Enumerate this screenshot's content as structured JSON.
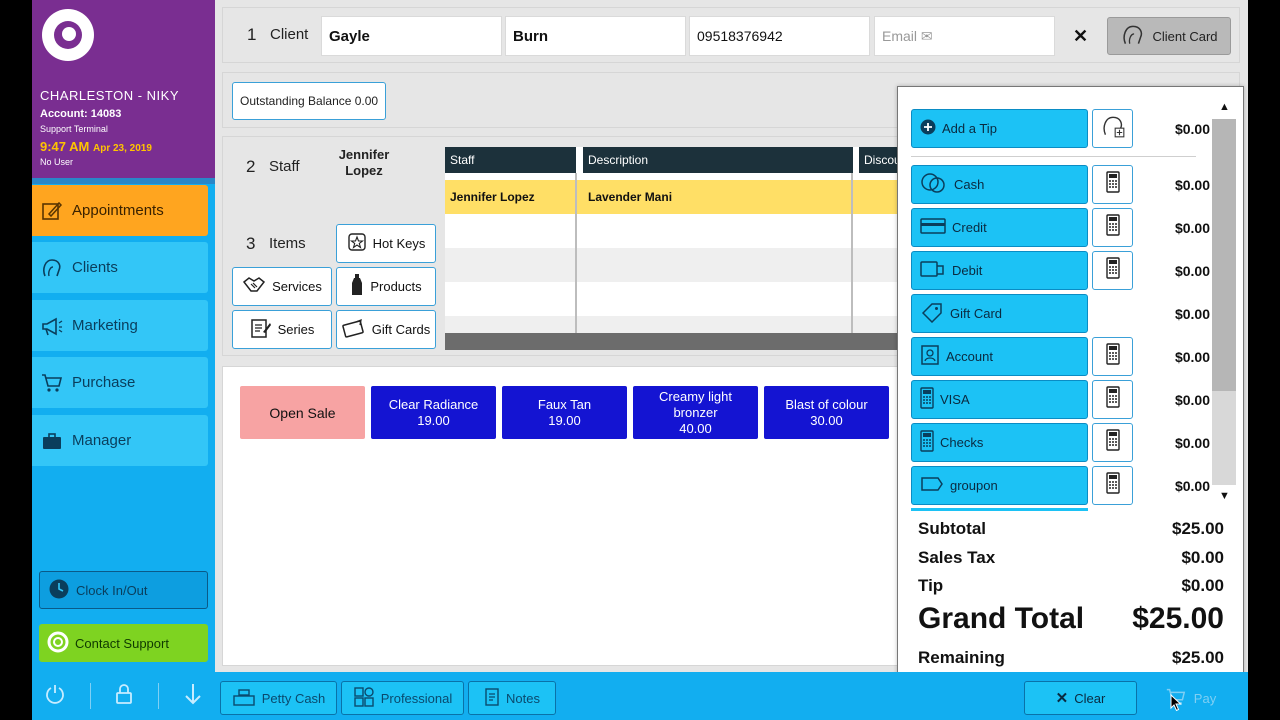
{
  "sidebar": {
    "location": "CHARLESTON - NIKY",
    "account": "Account: 14083",
    "terminal": "Support Terminal",
    "time": "9:47 AM",
    "date": "Apr 23, 2019",
    "user": "No User",
    "nav": [
      {
        "label": "Appointments",
        "icon": "calendar-edit-icon",
        "active": true
      },
      {
        "label": "Clients",
        "icon": "client-head-icon",
        "active": false
      },
      {
        "label": "Marketing",
        "icon": "megaphone-icon",
        "active": false
      },
      {
        "label": "Purchase",
        "icon": "cart-icon",
        "active": false
      },
      {
        "label": "Manager",
        "icon": "briefcase-icon",
        "active": false
      }
    ],
    "clock_button": "Clock In/Out",
    "support_button": "Contact Support",
    "footer_icons": [
      "power-icon",
      "lock-icon",
      "arrow-down-icon"
    ]
  },
  "client": {
    "step": "1",
    "label": "Client",
    "first_name": "Gayle",
    "last_name": "Burn",
    "phone": "09518376942",
    "email_placeholder": "Email ✉",
    "card_button": "Client Card"
  },
  "balance": "Outstanding Balance 0.00",
  "staff": {
    "step": "2",
    "label": "Staff",
    "name": "Jennifer Lopez"
  },
  "items": {
    "step": "3",
    "label": "Items",
    "tiles": {
      "hot_keys": "Hot Keys",
      "services": "Services",
      "products": "Products",
      "series": "Series",
      "gift_cards": "Gift Cards"
    }
  },
  "grid": {
    "headers": {
      "staff": "Staff",
      "description": "Description",
      "discount": "Discou"
    },
    "rows": [
      {
        "staff": "Jennifer Lopez",
        "description": "Lavender Mani"
      }
    ]
  },
  "hotkeys": {
    "open_sale": "Open Sale",
    "items": [
      {
        "name": "Clear Radiance",
        "price": "19.00"
      },
      {
        "name": "Faux Tan",
        "price": "19.00"
      },
      {
        "name": "Creamy light bronzer",
        "price": "40.00"
      },
      {
        "name": "Blast of colour",
        "price": "30.00"
      }
    ]
  },
  "payment": {
    "tip": {
      "label": "Add a Tip",
      "amount": "$0.00"
    },
    "methods": [
      {
        "label": "Cash",
        "amount": "$0.00",
        "calc": true
      },
      {
        "label": "Credit",
        "amount": "$0.00",
        "calc": true
      },
      {
        "label": "Debit",
        "amount": "$0.00",
        "calc": true
      },
      {
        "label": "Gift Card",
        "amount": "$0.00",
        "calc": false
      },
      {
        "label": "Account",
        "amount": "$0.00",
        "calc": true
      },
      {
        "label": "VISA",
        "amount": "$0.00",
        "calc": true
      },
      {
        "label": "Checks",
        "amount": "$0.00",
        "calc": true
      },
      {
        "label": "groupon",
        "amount": "$0.00",
        "calc": true
      }
    ],
    "totals": {
      "subtotal_label": "Subtotal",
      "subtotal": "$25.00",
      "tax_label": "Sales Tax",
      "tax": "$0.00",
      "tip_label": "Tip",
      "tip": "$0.00",
      "grand_label": "Grand Total",
      "grand": "$25.00",
      "remaining_label": "Remaining",
      "remaining": "$25.00"
    }
  },
  "bottom": {
    "petty_cash": "Petty Cash",
    "professional": "Professional",
    "notes": "Notes",
    "clear": "Clear",
    "pay": "Pay"
  },
  "colors": {
    "brand_purple": "#7a2e91",
    "sidebar_blue": "#12aef0",
    "active_orange": "#ffa51f",
    "hotkey_blue": "#1414d2",
    "selected_row_yellow": "#ffdf66",
    "support_green": "#7ed321"
  }
}
